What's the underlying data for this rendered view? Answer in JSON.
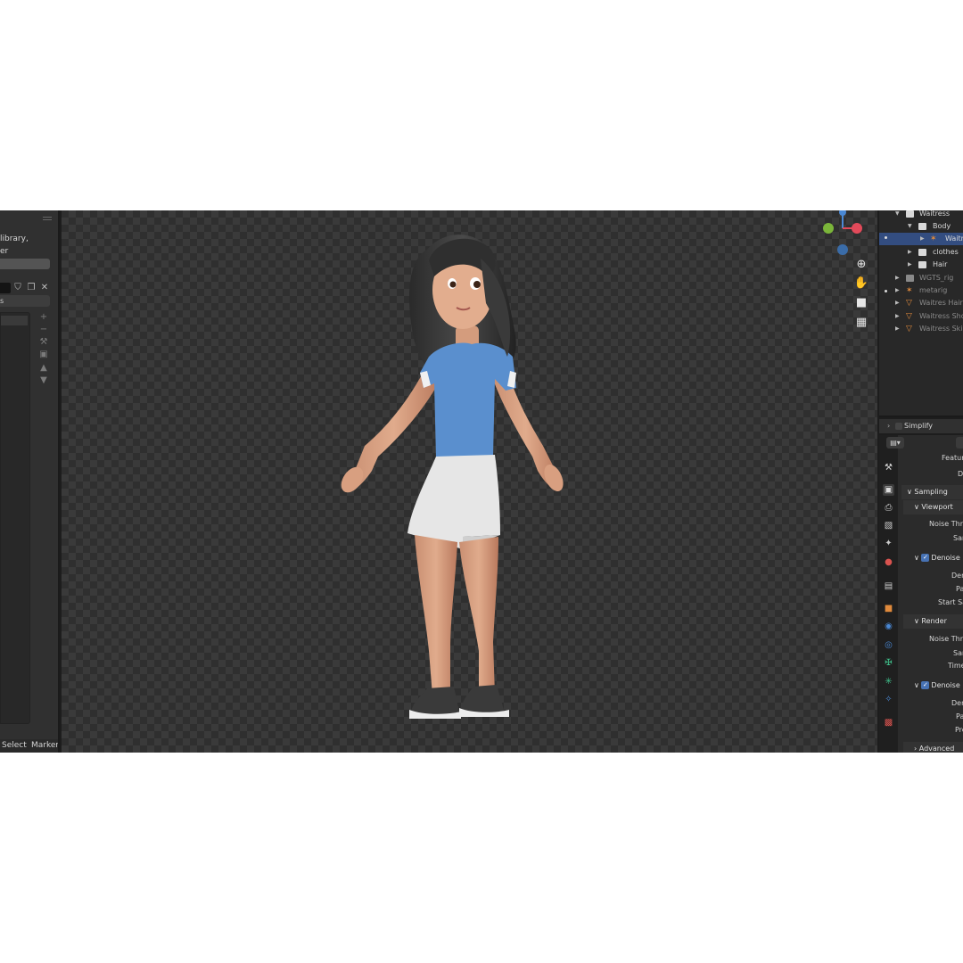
{
  "left_panel": {
    "line1": "library,",
    "line2": "er",
    "field2_text": "s",
    "icons": [
      "shield-icon",
      "copy-icon",
      "close-icon"
    ],
    "side_icons": [
      "plus-icon",
      "minus-icon",
      "eyedropper-icon",
      "filter-icon",
      "arrow-up-icon",
      "arrow-down-icon"
    ],
    "footer": {
      "select": "Select",
      "marker": "Marker"
    }
  },
  "outliner": {
    "rows": [
      {
        "label": "Waitress"
      },
      {
        "label": "Body"
      },
      {
        "label": "Waitr"
      },
      {
        "label": "clothes"
      },
      {
        "label": "Hair"
      },
      {
        "label": "WGTS_rig"
      },
      {
        "label": "metarig"
      },
      {
        "label": "Waitres Hair"
      },
      {
        "label": "Waitress Shoe"
      },
      {
        "label": "Waitress Skin"
      }
    ]
  },
  "properties": {
    "simplify": "Simplify",
    "feature": "Feature",
    "de": "De",
    "sampling": "Sampling",
    "viewport": "Viewport",
    "noise_threshold_1": "Noise Thre",
    "samples_1": "Sar",
    "denoise_1": "Denoise",
    "denoiser_1": "Den",
    "passes_1": "Pa",
    "start_sample": "Start Sa",
    "render": "Render",
    "noise_threshold_2": "Noise Thre",
    "samples_2": "Sar",
    "time_limit": "Time",
    "denoise_2": "Denoise",
    "denoiser_2": "Den",
    "passes_2": "Pa",
    "prefilter": "Pre",
    "advanced": "Advanced"
  },
  "colors": {
    "selection": "#334d80",
    "accent_blue": "#4772b3",
    "axis_x": "#e24a5a",
    "axis_y": "#7bb53a",
    "axis_z": "#4a88d4",
    "shirt": "#5a8fce",
    "skirt": "#e8e8e8"
  }
}
